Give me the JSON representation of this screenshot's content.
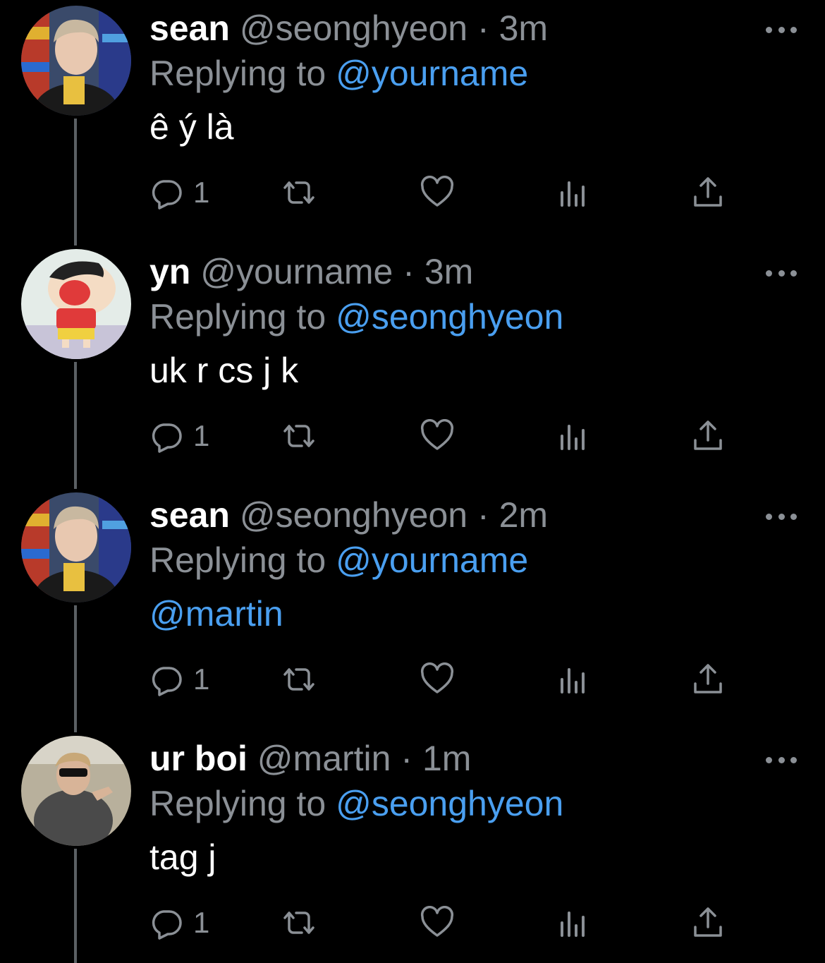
{
  "tweets": [
    {
      "name": "sean",
      "handle": "@seonghyeon",
      "time": "3m",
      "replying_prefix": "Replying to",
      "replying_to": "@yourname",
      "body": "ê ý là",
      "body_is_mention": false,
      "reply_count": "1",
      "avatar": "photo-young-man-store"
    },
    {
      "name": "yn",
      "handle": "@yourname",
      "time": "3m",
      "replying_prefix": "Replying to",
      "replying_to": "@seonghyeon",
      "body": "uk r cs j k",
      "body_is_mention": false,
      "reply_count": "1",
      "avatar": "cartoon-boy-shouting"
    },
    {
      "name": "sean",
      "handle": "@seonghyeon",
      "time": "2m",
      "replying_prefix": "Replying to",
      "replying_to": "@yourname",
      "body": "@martin",
      "body_is_mention": true,
      "reply_count": "1",
      "avatar": "photo-young-man-store"
    },
    {
      "name": "ur boi",
      "handle": "@martin",
      "time": "1m",
      "replying_prefix": "Replying to",
      "replying_to": "@seonghyeon",
      "body": "tag j",
      "body_is_mention": false,
      "reply_count": "1",
      "avatar": "photo-man-sunglasses"
    }
  ],
  "separator": "·",
  "colors": {
    "background": "#000000",
    "name": "#ffffff",
    "secondary": "#8b9096",
    "link": "#4a9ff0",
    "thread_line": "#5b6064"
  },
  "icons": [
    "reply-icon",
    "retweet-icon",
    "like-icon",
    "stats-icon",
    "share-icon",
    "more-icon"
  ]
}
